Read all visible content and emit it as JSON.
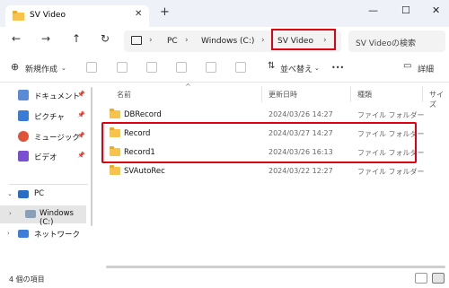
{
  "window": {
    "tab_title": "SV Video",
    "tab_close": "✕",
    "new_tab": "+",
    "controls": [
      "—",
      "☐",
      "✕"
    ]
  },
  "nav": {
    "back": "←",
    "forward": "→",
    "up": "↑",
    "refresh": "↻",
    "breadcrumbs": [
      "PC",
      "Windows (C:)",
      "SV Video"
    ],
    "chevron": "›",
    "search_placeholder": "SV Videoの検索"
  },
  "commands": {
    "new": "新規作成",
    "sort": "並べ替え",
    "more": "•••",
    "details": "詳細"
  },
  "sidebar": {
    "quick": [
      {
        "label": "ドキュメント",
        "icon": "documents-icon",
        "color": "#5b8bd6"
      },
      {
        "label": "ピクチャ",
        "icon": "pictures-icon",
        "color": "#3a7bd5"
      },
      {
        "label": "ミュージック",
        "icon": "music-icon",
        "color": "#e0533a"
      },
      {
        "label": "ビデオ",
        "icon": "videos-icon",
        "color": "#7b4fd1"
      }
    ],
    "pc": "PC",
    "drive": "Windows (C:)",
    "network": "ネットワーク"
  },
  "columns": {
    "name": "名前",
    "date": "更新日時",
    "type": "種類",
    "size": "サイズ"
  },
  "files": [
    {
      "name": "DBRecord",
      "date": "2024/03/26 14:27",
      "type": "ファイル フォルダー"
    },
    {
      "name": "Record",
      "date": "2024/03/27 14:27",
      "type": "ファイル フォルダー"
    },
    {
      "name": "Record1",
      "date": "2024/03/26 16:13",
      "type": "ファイル フォルダー"
    },
    {
      "name": "SVAutoRec",
      "date": "2024/03/22 12:27",
      "type": "ファイル フォルダー"
    }
  ],
  "status": {
    "count": "4 個の項目"
  },
  "colors": {
    "highlight": "#e00010",
    "folder": "#f7c34c",
    "accent": "#0067c0"
  }
}
